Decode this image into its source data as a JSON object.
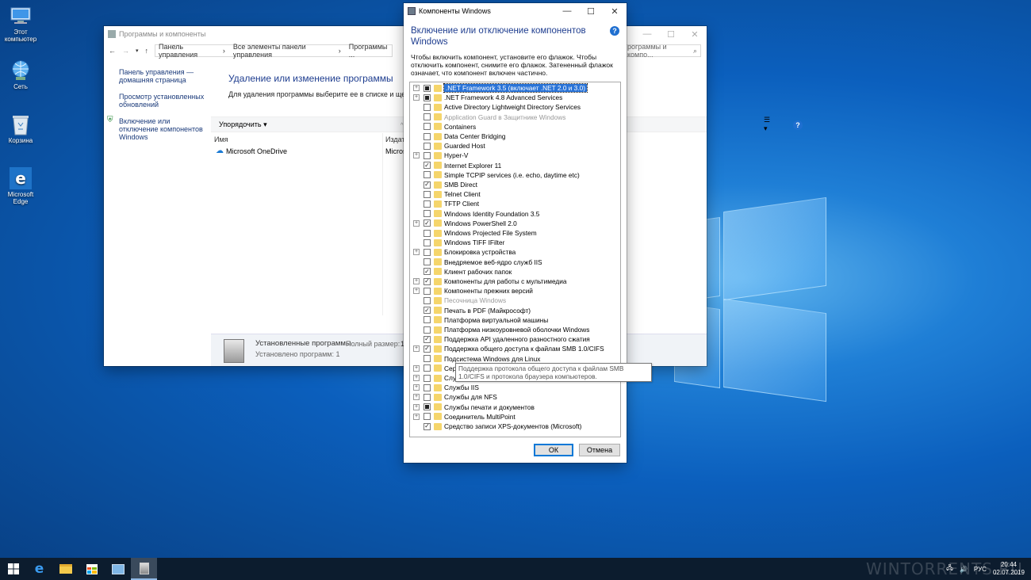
{
  "desktop": {
    "icons": [
      {
        "label": "Этот компьютер",
        "icon": "this-pc-icon"
      },
      {
        "label": "Сеть",
        "icon": "network-icon"
      },
      {
        "label": "Корзина",
        "icon": "recycle-bin-icon"
      },
      {
        "label": "Microsoft Edge",
        "icon": "edge-icon"
      }
    ]
  },
  "programs_window": {
    "title": "Программы и компоненты",
    "breadcrumb": [
      "Панель управления",
      "Все элементы панели управления",
      "Программы ..."
    ],
    "search_placeholder": "рограммы и компо...",
    "sidebar": [
      "Панель управления — домашняя страница",
      "Просмотр установленных обновлений",
      "Включение или отключение компонентов Windows"
    ],
    "heading": "Удаление или изменение программы",
    "subheading": "Для удаления программы выберите ее в списке и щелкнит",
    "organize_label": "Упорядочить",
    "columns": [
      "Имя",
      "Издат"
    ],
    "programs": [
      {
        "name": "Microsoft OneDrive",
        "publisher": "Micros"
      }
    ],
    "status": {
      "title": "Установленные программы",
      "size_label": "Полный размер:",
      "size_value": "1",
      "count": "Установлено программ: 1"
    }
  },
  "components_dialog": {
    "title": "Компоненты Windows",
    "heading": "Включение или отключение компонентов Windows",
    "description": "Чтобы включить компонент, установите его флажок. Чтобы отключить компонент, снимите его флажок. Затененный флажок означает, что компонент включен частично.",
    "features": [
      {
        "label": ".NET Framework 3.5 (включает .NET 2.0 и 3.0)",
        "state": "partial",
        "expandable": true,
        "selected": true
      },
      {
        "label": ".NET Framework 4.8 Advanced Services",
        "state": "partial",
        "expandable": true
      },
      {
        "label": "Active Directory Lightweight Directory Services",
        "state": "unchecked",
        "expandable": false
      },
      {
        "label": "Application Guard в Защитнике Windows",
        "state": "unchecked",
        "expandable": false,
        "disabled": true
      },
      {
        "label": "Containers",
        "state": "unchecked",
        "expandable": false
      },
      {
        "label": "Data Center Bridging",
        "state": "unchecked",
        "expandable": false
      },
      {
        "label": "Guarded Host",
        "state": "unchecked",
        "expandable": false
      },
      {
        "label": "Hyper-V",
        "state": "unchecked",
        "expandable": true
      },
      {
        "label": "Internet Explorer 11",
        "state": "checked",
        "expandable": false
      },
      {
        "label": "Simple TCPIP services (i.e. echo, daytime etc)",
        "state": "unchecked",
        "expandable": false
      },
      {
        "label": "SMB Direct",
        "state": "checked",
        "expandable": false
      },
      {
        "label": "Telnet Client",
        "state": "unchecked",
        "expandable": false
      },
      {
        "label": "TFTP Client",
        "state": "unchecked",
        "expandable": false
      },
      {
        "label": "Windows Identity Foundation 3.5",
        "state": "unchecked",
        "expandable": false
      },
      {
        "label": "Windows PowerShell 2.0",
        "state": "checked",
        "expandable": true
      },
      {
        "label": "Windows Projected File System",
        "state": "unchecked",
        "expandable": false
      },
      {
        "label": "Windows TIFF IFilter",
        "state": "unchecked",
        "expandable": false
      },
      {
        "label": "Блокировка устройства",
        "state": "unchecked",
        "expandable": true
      },
      {
        "label": "Внедряемое веб-ядро служб IIS",
        "state": "unchecked",
        "expandable": false
      },
      {
        "label": "Клиент рабочих папок",
        "state": "checked",
        "expandable": false
      },
      {
        "label": "Компоненты для работы с мультимедиа",
        "state": "checked",
        "expandable": true
      },
      {
        "label": "Компоненты прежних версий",
        "state": "unchecked",
        "expandable": true
      },
      {
        "label": "Песочница Windows",
        "state": "unchecked",
        "expandable": false,
        "disabled": true
      },
      {
        "label": "Печать в PDF (Майкрософт)",
        "state": "checked",
        "expandable": false
      },
      {
        "label": "Платформа виртуальной машины",
        "state": "unchecked",
        "expandable": false
      },
      {
        "label": "Платформа низкоуровневой оболочки Windows",
        "state": "unchecked",
        "expandable": false
      },
      {
        "label": "Поддержка API удаленного разностного сжатия",
        "state": "checked",
        "expandable": false
      },
      {
        "label": "Поддержка общего доступа к файлам SMB 1.0/CIFS",
        "state": "checked",
        "expandable": true
      },
      {
        "label": "Подсистема Windows для Linux",
        "state": "unchecked",
        "expandable": false
      },
      {
        "label": "Серв",
        "state": "unchecked",
        "expandable": true
      },
      {
        "label": "Служ",
        "state": "unchecked",
        "expandable": true
      },
      {
        "label": "Службы IIS",
        "state": "unchecked",
        "expandable": true
      },
      {
        "label": "Службы для NFS",
        "state": "unchecked",
        "expandable": true
      },
      {
        "label": "Службы печати и документов",
        "state": "partial",
        "expandable": true
      },
      {
        "label": "Соединитель MultiPoint",
        "state": "unchecked",
        "expandable": true
      },
      {
        "label": "Средство записи XPS-документов (Microsoft)",
        "state": "checked",
        "expandable": false
      }
    ],
    "tooltip": "Поддержка протокола общего доступа к файлам SMB 1.0/CIFS и протокола браузера компьютеров.",
    "ok_label": "ОК",
    "cancel_label": "Отмена"
  },
  "taskbar": {
    "language": "РУС",
    "time": "20:44",
    "date": "02.07.2019"
  },
  "watermark": "WINTORRENTS.RU"
}
